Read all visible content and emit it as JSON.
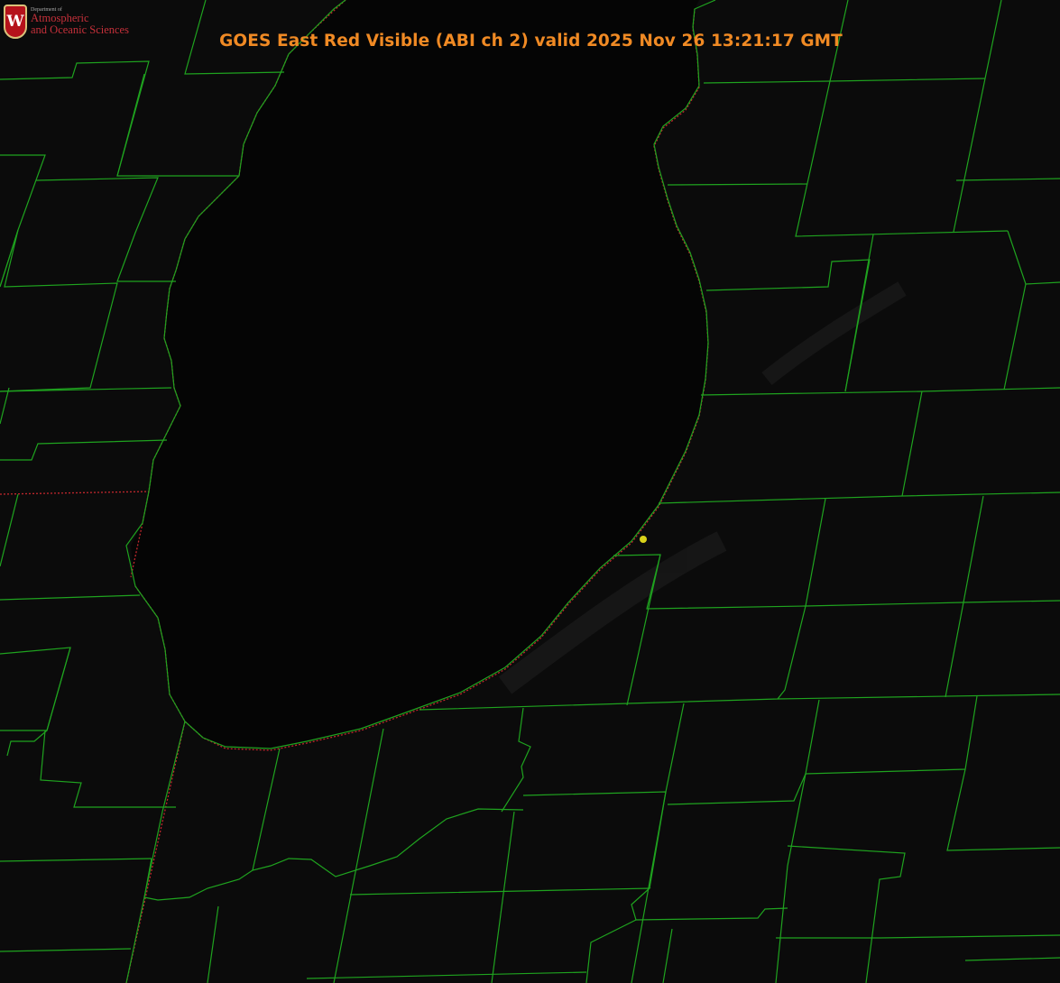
{
  "header": {
    "title": "GOES East Red Visible (ABI ch 2) valid 2025 Nov 26 13:21:17 GMT"
  },
  "logo": {
    "emblem_letter": "W",
    "department_line": "Department of",
    "name_line1": "Atmospheric",
    "name_line2": "and Oceanic Sciences"
  },
  "map": {
    "background_color": "#0b0b0b",
    "lake_color": "#050505",
    "county_line_color": "#1fa31f",
    "state_line_color": "#c1272d",
    "station_marker_color": "#d9d21a",
    "icons": [
      "university-shield-icon",
      "station-marker-icon"
    ]
  }
}
